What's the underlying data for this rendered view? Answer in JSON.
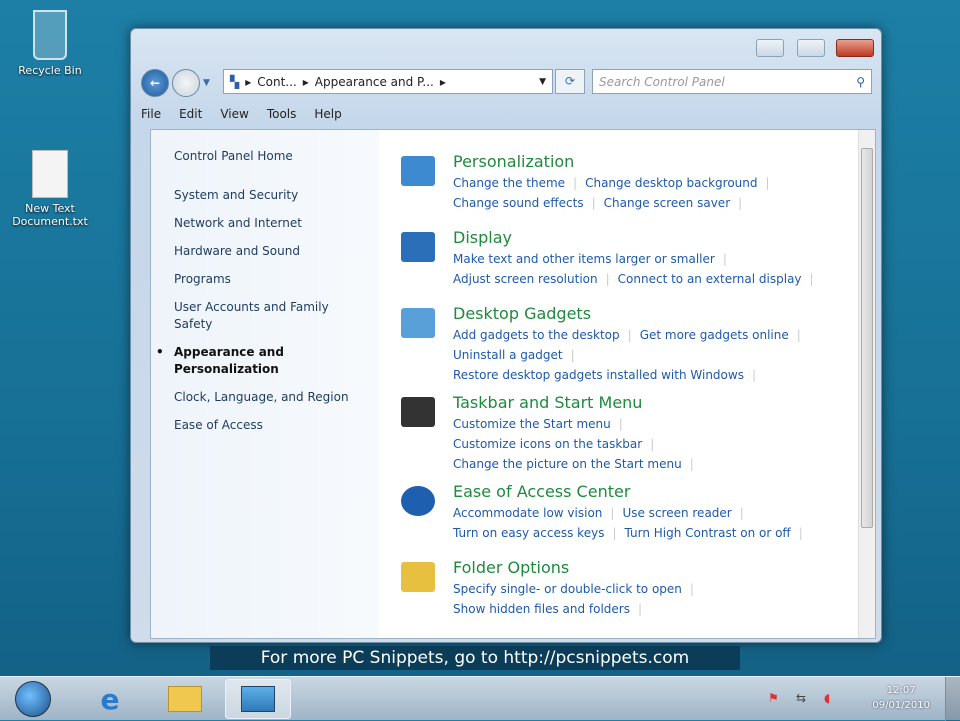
{
  "desktop": {
    "icons": [
      {
        "label": "Recycle Bin"
      },
      {
        "label": "New Text Document.txt"
      }
    ]
  },
  "window": {
    "address": {
      "crumbs": [
        "Cont...",
        "Appearance and P..."
      ]
    },
    "search_placeholder": "Search Control Panel",
    "menu": [
      "File",
      "Edit",
      "View",
      "Tools",
      "Help"
    ],
    "left_pane": {
      "home": "Control Panel Home",
      "items": [
        "System and Security",
        "Network and Internet",
        "Hardware and Sound",
        "Programs",
        "User Accounts and Family Safety",
        "Appearance and Personalization",
        "Clock, Language, and Region",
        "Ease of Access"
      ],
      "current": "Appearance and Personalization"
    },
    "categories": [
      {
        "title": "Personalization",
        "links": [
          [
            "Change the theme",
            "Change desktop background"
          ],
          [
            "Change sound effects",
            "Change screen saver"
          ]
        ]
      },
      {
        "title": "Display",
        "links": [
          [
            "Make text and other items larger or smaller"
          ],
          [
            "Adjust screen resolution",
            "Connect to an external display"
          ]
        ]
      },
      {
        "title": "Desktop Gadgets",
        "links": [
          [
            "Add gadgets to the desktop",
            "Get more gadgets online"
          ],
          [
            "Uninstall a gadget"
          ],
          [
            "Restore desktop gadgets installed with Windows"
          ]
        ]
      },
      {
        "title": "Taskbar and Start Menu",
        "links": [
          [
            "Customize the Start menu"
          ],
          [
            "Customize icons on the taskbar"
          ],
          [
            "Change the picture on the Start menu"
          ]
        ]
      },
      {
        "title": "Ease of Access Center",
        "links": [
          [
            "Accommodate low vision",
            "Use screen reader"
          ],
          [
            "Turn on easy access keys",
            "Turn High Contrast on or off"
          ]
        ]
      },
      {
        "title": "Folder Options",
        "links": [
          [
            "Specify single- or double-click to open"
          ],
          [
            "Show hidden files and folders"
          ]
        ]
      }
    ]
  },
  "caption": "For more PC Snippets, go to http://pcsnippets.com",
  "taskbar": {
    "time": "12:07",
    "date": "09/01/2010"
  }
}
